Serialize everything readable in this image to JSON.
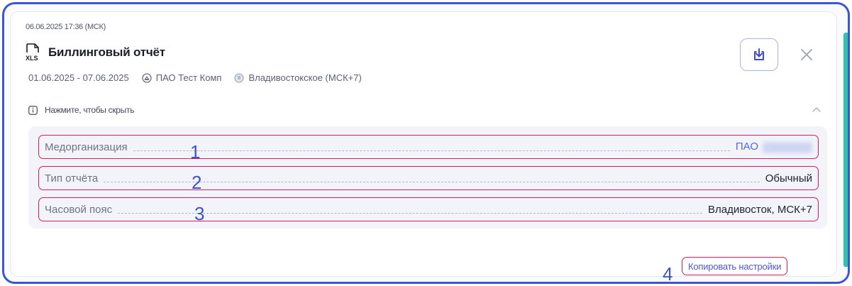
{
  "report": {
    "timestamp": "06.06.2025 17:36 (МСК)",
    "file_type": "XLS",
    "title": "Биллинговый отчёт",
    "period": "01.06.2025 - 07.06.2025",
    "organization": "ПАО Тест Комп",
    "timezone": "Владивостокское (МСК+7)"
  },
  "hint": {
    "text": "Нажмите, чтобы скрыть"
  },
  "settings": [
    {
      "label": "Медорганизация",
      "value": "ПАО",
      "marker": "1"
    },
    {
      "label": "Тип отчёта",
      "value": "Обычный",
      "marker": "2"
    },
    {
      "label": "Часовой пояс",
      "value": "Владивосток, МСК+7",
      "marker": "3"
    }
  ],
  "copy_button": {
    "label": "Копировать настройки",
    "marker": "4"
  },
  "colors": {
    "outer_border": "#3d54d6",
    "highlight": "#d81b60",
    "accent": "#5068e0",
    "side_accent": "#2fc4a4"
  },
  "icons": [
    "xls-file-icon",
    "organization-icon",
    "globe-icon",
    "download-icon",
    "close-icon",
    "info-icon",
    "chevron-up-icon"
  ]
}
